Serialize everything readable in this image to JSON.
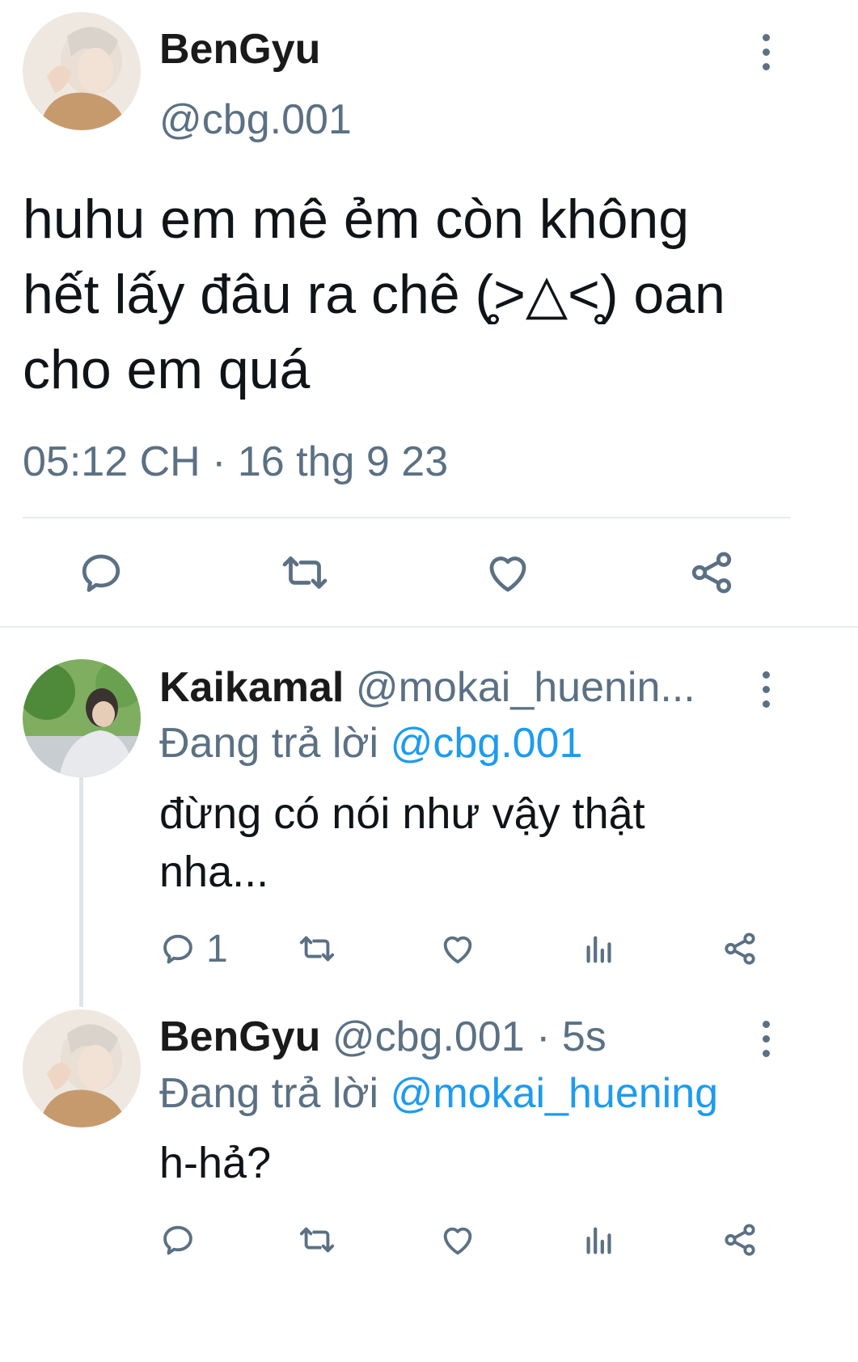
{
  "main_tweet": {
    "display_name": "BenGyu",
    "handle": "@cbg.001",
    "text_lines": [
      "huhu em mê ẻm còn không",
      "hết lấy đâu ra chê (̥̥̥̥>△<̥̥̥̥) oan",
      "cho em quá"
    ],
    "timestamp": "05:12 CH · 16 thg 9 23",
    "actions": [
      "reply-icon",
      "retweet-icon",
      "like-icon",
      "share-icon"
    ]
  },
  "replies": [
    {
      "display_name": "Kaikamal",
      "handle": "@mokai_huenin...",
      "replying_prefix": "Đang trả lời",
      "replying_to": "@cbg.001",
      "text_lines": [
        "đừng có nói như vậy thật",
        "nha..."
      ],
      "reply_count": "1"
    },
    {
      "display_name": "BenGyu",
      "handle": "@cbg.001 · 5s",
      "replying_prefix": "Đang trả lời",
      "replying_to": "@mokai_huening",
      "text_lines": [
        "h-hả?"
      ],
      "reply_count": ""
    }
  ],
  "colors": {
    "accent": "#1d9bf0",
    "secondary_text": "#5b7083",
    "divider": "#e6ecf0"
  }
}
